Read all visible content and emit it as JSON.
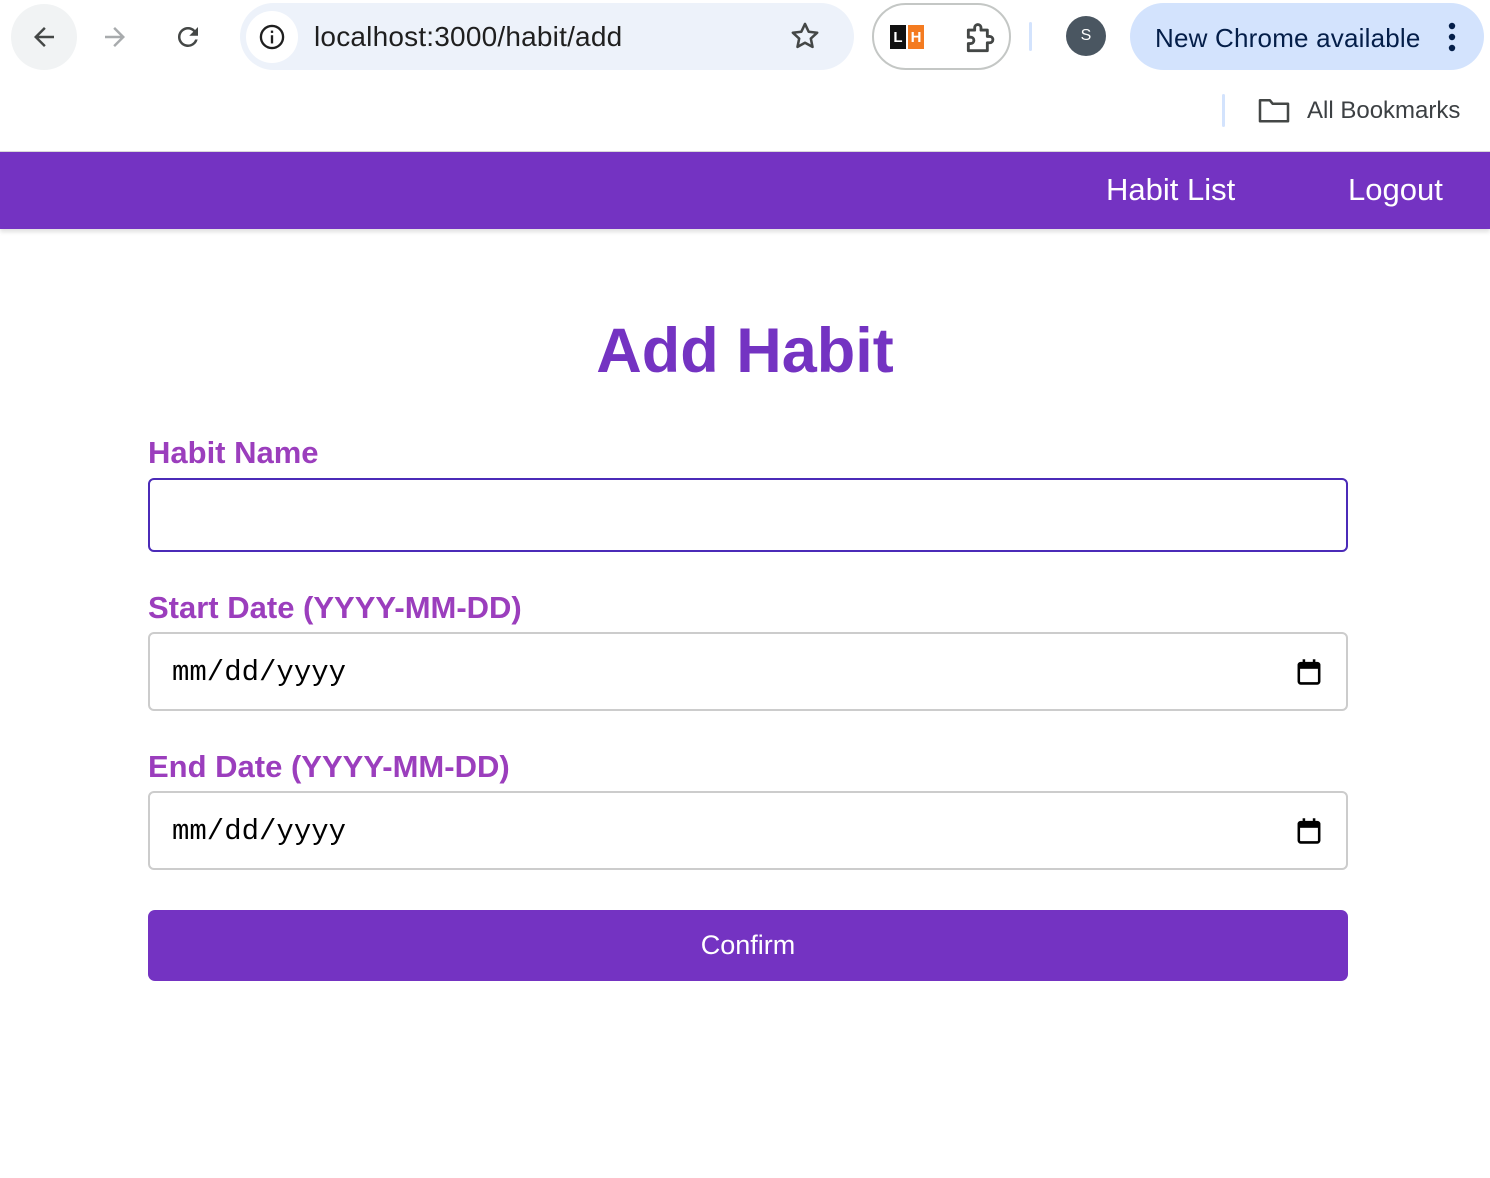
{
  "browser": {
    "url": "localhost:3000/habit/add",
    "profile_initial": "S",
    "update_label": "New Chrome available",
    "extension_badge": {
      "left": "L",
      "right": "H"
    },
    "bookmarks_label": "All Bookmarks",
    "icons": [
      "back-arrow-icon",
      "forward-arrow-icon",
      "reload-icon",
      "site-info-icon",
      "star-icon",
      "extension-icon",
      "puzzle-icon",
      "kebab-menu-icon",
      "folder-icon",
      "calendar-icon"
    ]
  },
  "nav": {
    "habit_list": "Habit List",
    "logout": "Logout"
  },
  "form": {
    "title": "Add Habit",
    "habit_name_label": "Habit Name",
    "habit_name_value": "",
    "start_date_label": "Start Date (YYYY-MM-DD)",
    "start_date_value": "mm/dd/yyyy",
    "end_date_label": "End Date (YYYY-MM-DD)",
    "end_date_value": "mm/dd/yyyy",
    "confirm_label": "Confirm"
  },
  "colors": {
    "primary": "#7433c2",
    "label": "#9b3ebd",
    "focus_border": "#4b2bb8",
    "omnibox_bg": "#edf2fa",
    "update_pill_bg": "#d3e3fd"
  }
}
